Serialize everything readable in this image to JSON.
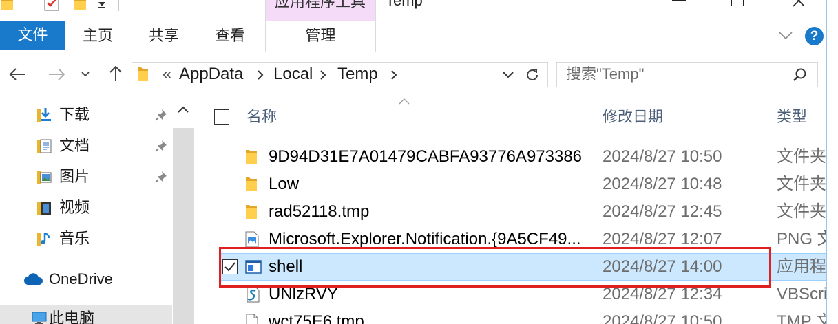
{
  "window": {
    "title": "Temp",
    "context_group": "应用程序工具",
    "accent_color": "#1979ca"
  },
  "quick_access": {
    "icons": [
      "quick-access-folder-icon",
      "properties-icon",
      "new-folder-icon",
      "customize-toolbar-dropdown-icon"
    ]
  },
  "ribbon": {
    "tabs": [
      {
        "label": "文件"
      },
      {
        "label": "主页"
      },
      {
        "label": "共享"
      },
      {
        "label": "查看"
      },
      {
        "label": "管理"
      }
    ],
    "help": "?",
    "context_color": "#f5dbf8"
  },
  "address_bar": {
    "overflow": "«",
    "crumbs": [
      "AppData",
      "Local",
      "Temp"
    ]
  },
  "search": {
    "placeholder": "搜索\"Temp\""
  },
  "nav_pane": {
    "items": [
      {
        "label": "下载",
        "icon": "downloads-icon",
        "pinned": true
      },
      {
        "label": "文档",
        "icon": "documents-icon",
        "pinned": true
      },
      {
        "label": "图片",
        "icon": "pictures-icon",
        "pinned": true
      },
      {
        "label": "视频",
        "icon": "videos-icon",
        "pinned": false
      },
      {
        "label": "音乐",
        "icon": "music-icon",
        "pinned": false
      },
      {
        "label": "OneDrive",
        "icon": "onedrive-icon",
        "pinned": false
      },
      {
        "label": "此电脑",
        "icon": "this-pc-icon",
        "pinned": false
      }
    ]
  },
  "columns": {
    "name": "名称",
    "modified": "修改日期",
    "type": "类型",
    "sort_indicator_icon": "sort-ascending-icon"
  },
  "files": [
    {
      "name": "9D94D31E7A01479CABFA93776A973386",
      "modified": "2024/8/27 10:50",
      "type": "文件夹",
      "icon": "folder-icon",
      "selected": false
    },
    {
      "name": "Low",
      "modified": "2024/8/27 10:48",
      "type": "文件夹",
      "icon": "folder-icon",
      "selected": false
    },
    {
      "name": "rad52118.tmp",
      "modified": "2024/8/27 12:45",
      "type": "文件夹",
      "icon": "folder-icon",
      "selected": false
    },
    {
      "name": "Microsoft.Explorer.Notification.{9A5CF49...",
      "modified": "2024/8/27 12:07",
      "type": "PNG 文",
      "icon": "png-image-icon",
      "selected": false
    },
    {
      "name": "shell",
      "modified": "2024/8/27 14:00",
      "type": "应用程序",
      "icon": "application-icon",
      "selected": true
    },
    {
      "name": "UNlzRVY",
      "modified": "2024/8/27 12:34",
      "type": "VBScrip",
      "icon": "vbscript-icon",
      "selected": false
    },
    {
      "name": "wct75E6.tmp",
      "modified": "2024/8/27 10:50",
      "type": "TMP 文",
      "icon": "file-icon",
      "selected": false
    }
  ],
  "colors": {
    "selection": "#cce8ff",
    "selection_border": "#99d1ff",
    "annotation": "#e02020",
    "header_text": "#4c607a",
    "detail_text": "#6d6d6d"
  }
}
